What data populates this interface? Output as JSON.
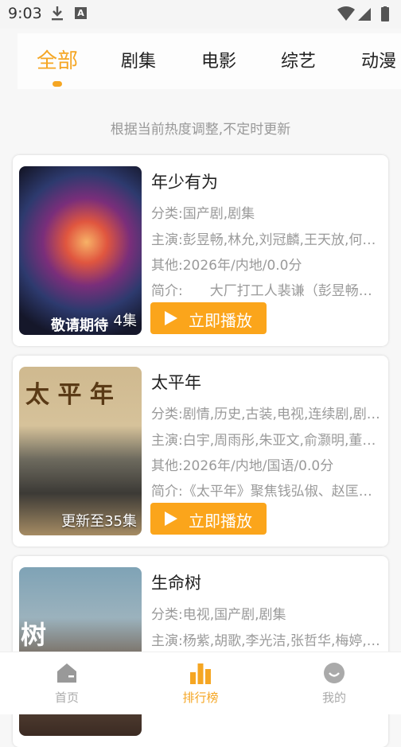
{
  "status": {
    "time": "9:03",
    "a_badge": "A"
  },
  "tabs": [
    {
      "label": "全部"
    },
    {
      "label": "剧集"
    },
    {
      "label": "电影"
    },
    {
      "label": "综艺"
    },
    {
      "label": "动漫"
    }
  ],
  "hint": "根据当前热度调整,不定时更新",
  "items": [
    {
      "title": "年少有为",
      "category": "分类:国产剧,剧集",
      "cast": "主演:彭昱畅,林允,刘冠麟,王天放,何…",
      "other": "其他:2026年/内地/0.0分",
      "intro": "简介:　　大厂打工人裴谦（彭昱畅…",
      "badge": "4集",
      "play": "立即播放",
      "poster_text": "敬请期待"
    },
    {
      "title": "太平年",
      "category": "分类:剧情,历史,古装,电视,连续剧,剧…",
      "cast": "主演:白宇,周雨彤,朱亚文,俞灏明,董…",
      "other": "其他:2026年/内地/国语/0.0分",
      "intro": "简介:《太平年》聚焦钱弘俶、赵匡…",
      "badge": "更新至35集",
      "play": "立即播放",
      "poster_text": "太 平 年"
    },
    {
      "title": "生命树",
      "category": "分类:电视,国产剧,剧集",
      "cast": "主演:杨紫,胡歌,李光洁,张哲华,梅婷,…",
      "other": "",
      "intro": "",
      "badge": "",
      "play": "",
      "poster_text": "树"
    }
  ],
  "nav": [
    {
      "label": "首页",
      "icon": "home-icon"
    },
    {
      "label": "排行榜",
      "icon": "chart-icon"
    },
    {
      "label": "我的",
      "icon": "profile-icon"
    }
  ],
  "colors": {
    "accent": "#f5a623",
    "button": "#fba51b"
  }
}
